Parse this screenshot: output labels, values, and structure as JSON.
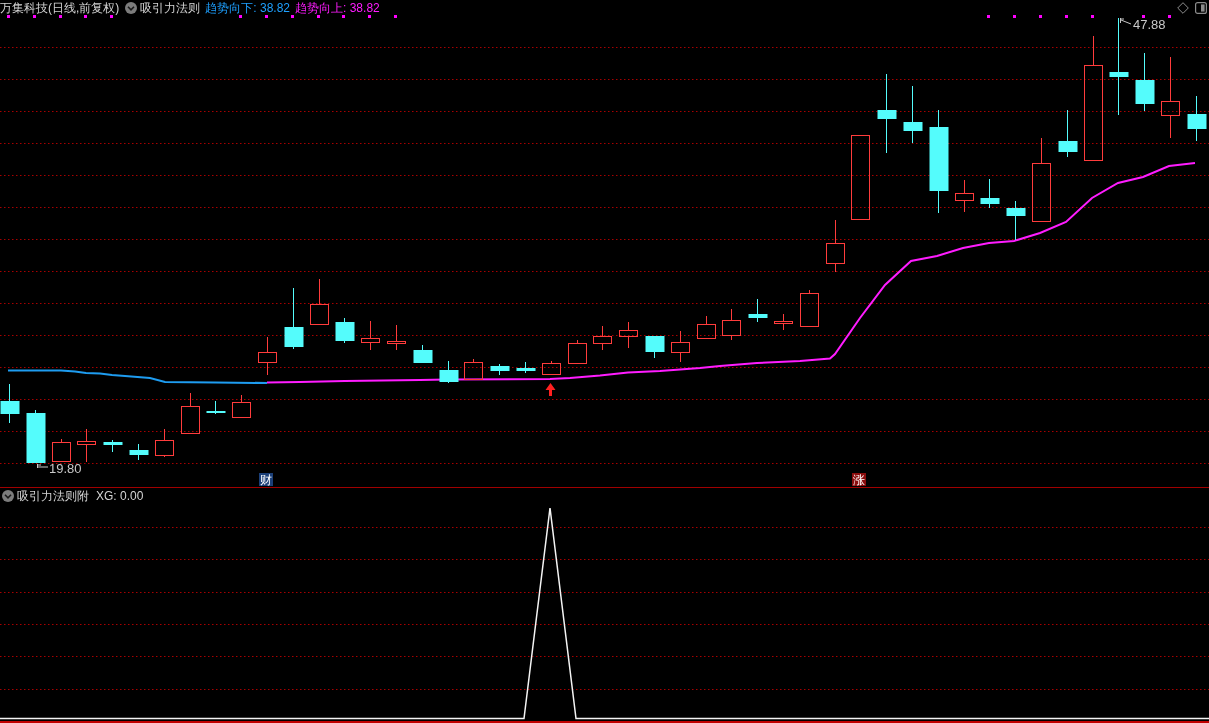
{
  "header": {
    "title": "万集科技(日线,前复权)",
    "indicator": "吸引力法则",
    "readings": [
      {
        "kind": "down",
        "text": "趋势向下: 38.82"
      },
      {
        "kind": "up",
        "text": "趋势向上: 38.82"
      }
    ]
  },
  "main_chart": {
    "high_label": "47.88",
    "low_label": "19.80",
    "badges": [
      {
        "kind": "finance",
        "text": "财"
      },
      {
        "kind": "limit",
        "text": "涨"
      }
    ]
  },
  "sub_panel": {
    "indicator": "吸引力法则附",
    "reading": "XG: 0.00"
  }
}
